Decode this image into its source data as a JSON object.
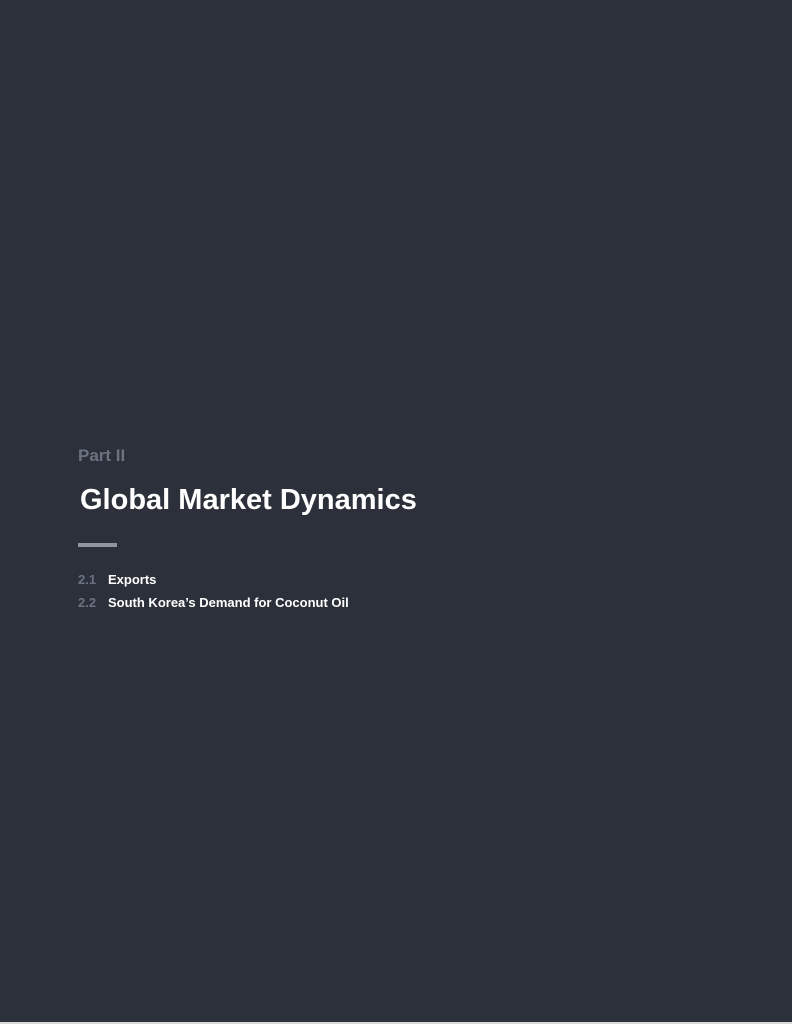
{
  "section": {
    "part_label": "Part II",
    "title": "Global Market Dynamics"
  },
  "toc": {
    "items": [
      {
        "number": "2.1",
        "label": "Exports"
      },
      {
        "number": "2.2",
        "label": "South Korea’s Demand for Coconut Oil"
      }
    ]
  },
  "colors": {
    "background": "#2b303a",
    "title": "#ffffff",
    "muted": "#6b7280",
    "rule": "#8f96a0"
  }
}
